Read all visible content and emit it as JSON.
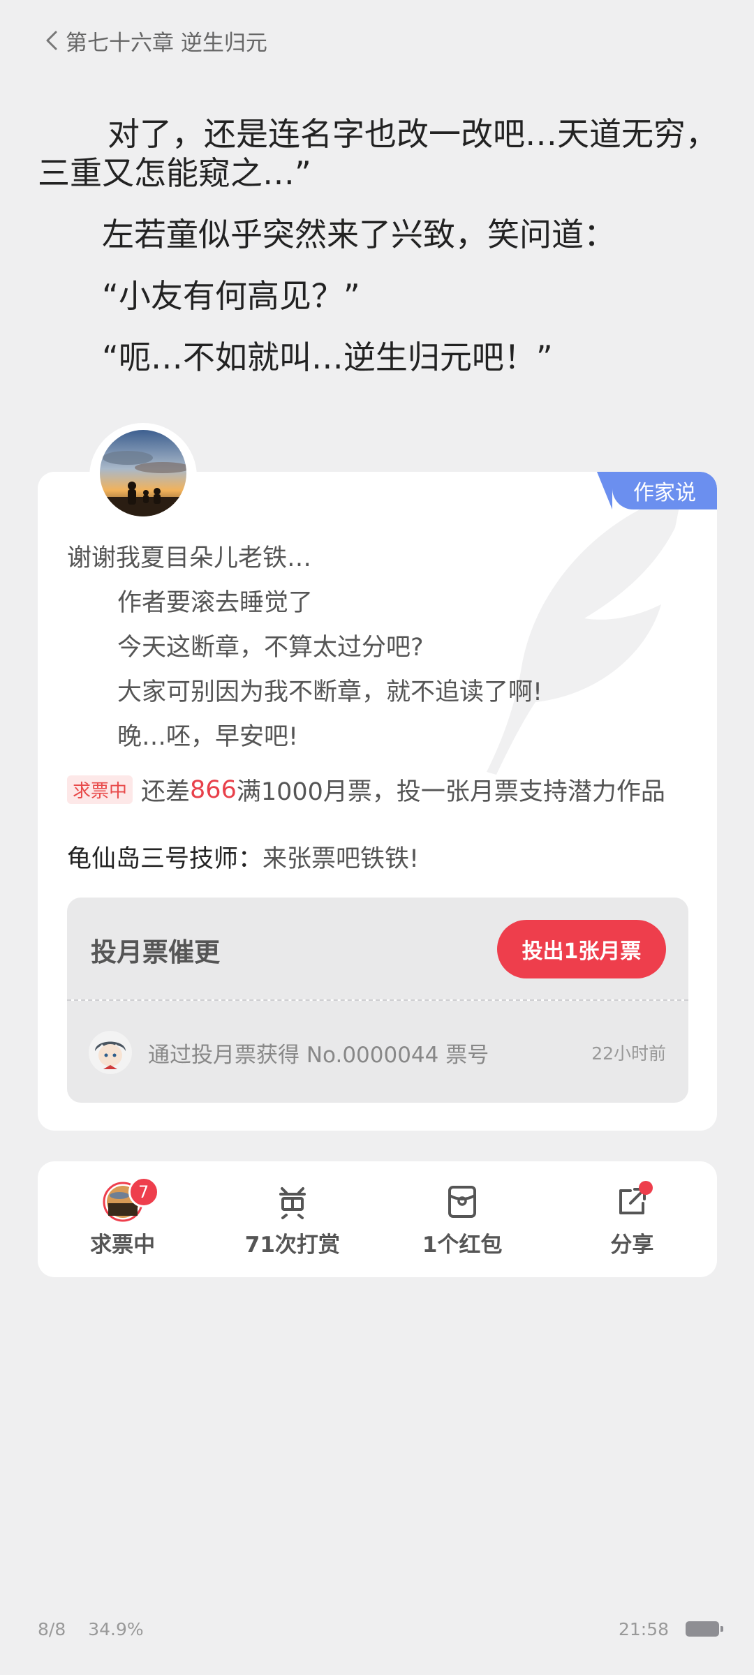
{
  "header": {
    "chapter_title": "第七十六章 逆生归元"
  },
  "content": {
    "paragraphs": [
      "对了，还是连名字也改一改吧…天道无穷，三重又怎能窥之…”",
      "左若童似乎突然来了兴致，笑问道：",
      "“小友有何高见？”",
      "“呃…不如就叫…逆生归元吧！”"
    ]
  },
  "author_card": {
    "tag": "作家说",
    "note_lines": [
      "谢谢我夏目朵儿老铁…",
      "作者要滚去睡觉了",
      "今天这断章，不算太过分吧?",
      "大家可别因为我不断章，就不追读了啊!",
      "晚…呸，早安吧!"
    ],
    "ticket_badge": "求票中",
    "ticket_prefix": "还差",
    "ticket_number": "866",
    "ticket_suffix": "满1000月票，投一张月票支持潜力作品",
    "comment_name": "龟仙岛三号技师：",
    "comment_text": "来张票吧铁铁!",
    "vote_title": "投月票催更",
    "vote_button": "投出1张月票",
    "record_text": "通过投月票获得 No.0000044 票号",
    "record_time": "22小时前"
  },
  "actions": [
    {
      "label": "求票中",
      "icon": "avatar-icon",
      "badge": "7"
    },
    {
      "label": "71次打赏",
      "icon": "reward-icon"
    },
    {
      "label": "1个红包",
      "icon": "red-packet-icon"
    },
    {
      "label": "分享",
      "icon": "share-icon"
    }
  ],
  "footer": {
    "page": "8/8",
    "progress": "34.9%",
    "time": "21:58"
  },
  "colors": {
    "accent_red": "#ee3e4c",
    "author_tag_blue": "#6b8fef",
    "background": "#efeff0"
  }
}
